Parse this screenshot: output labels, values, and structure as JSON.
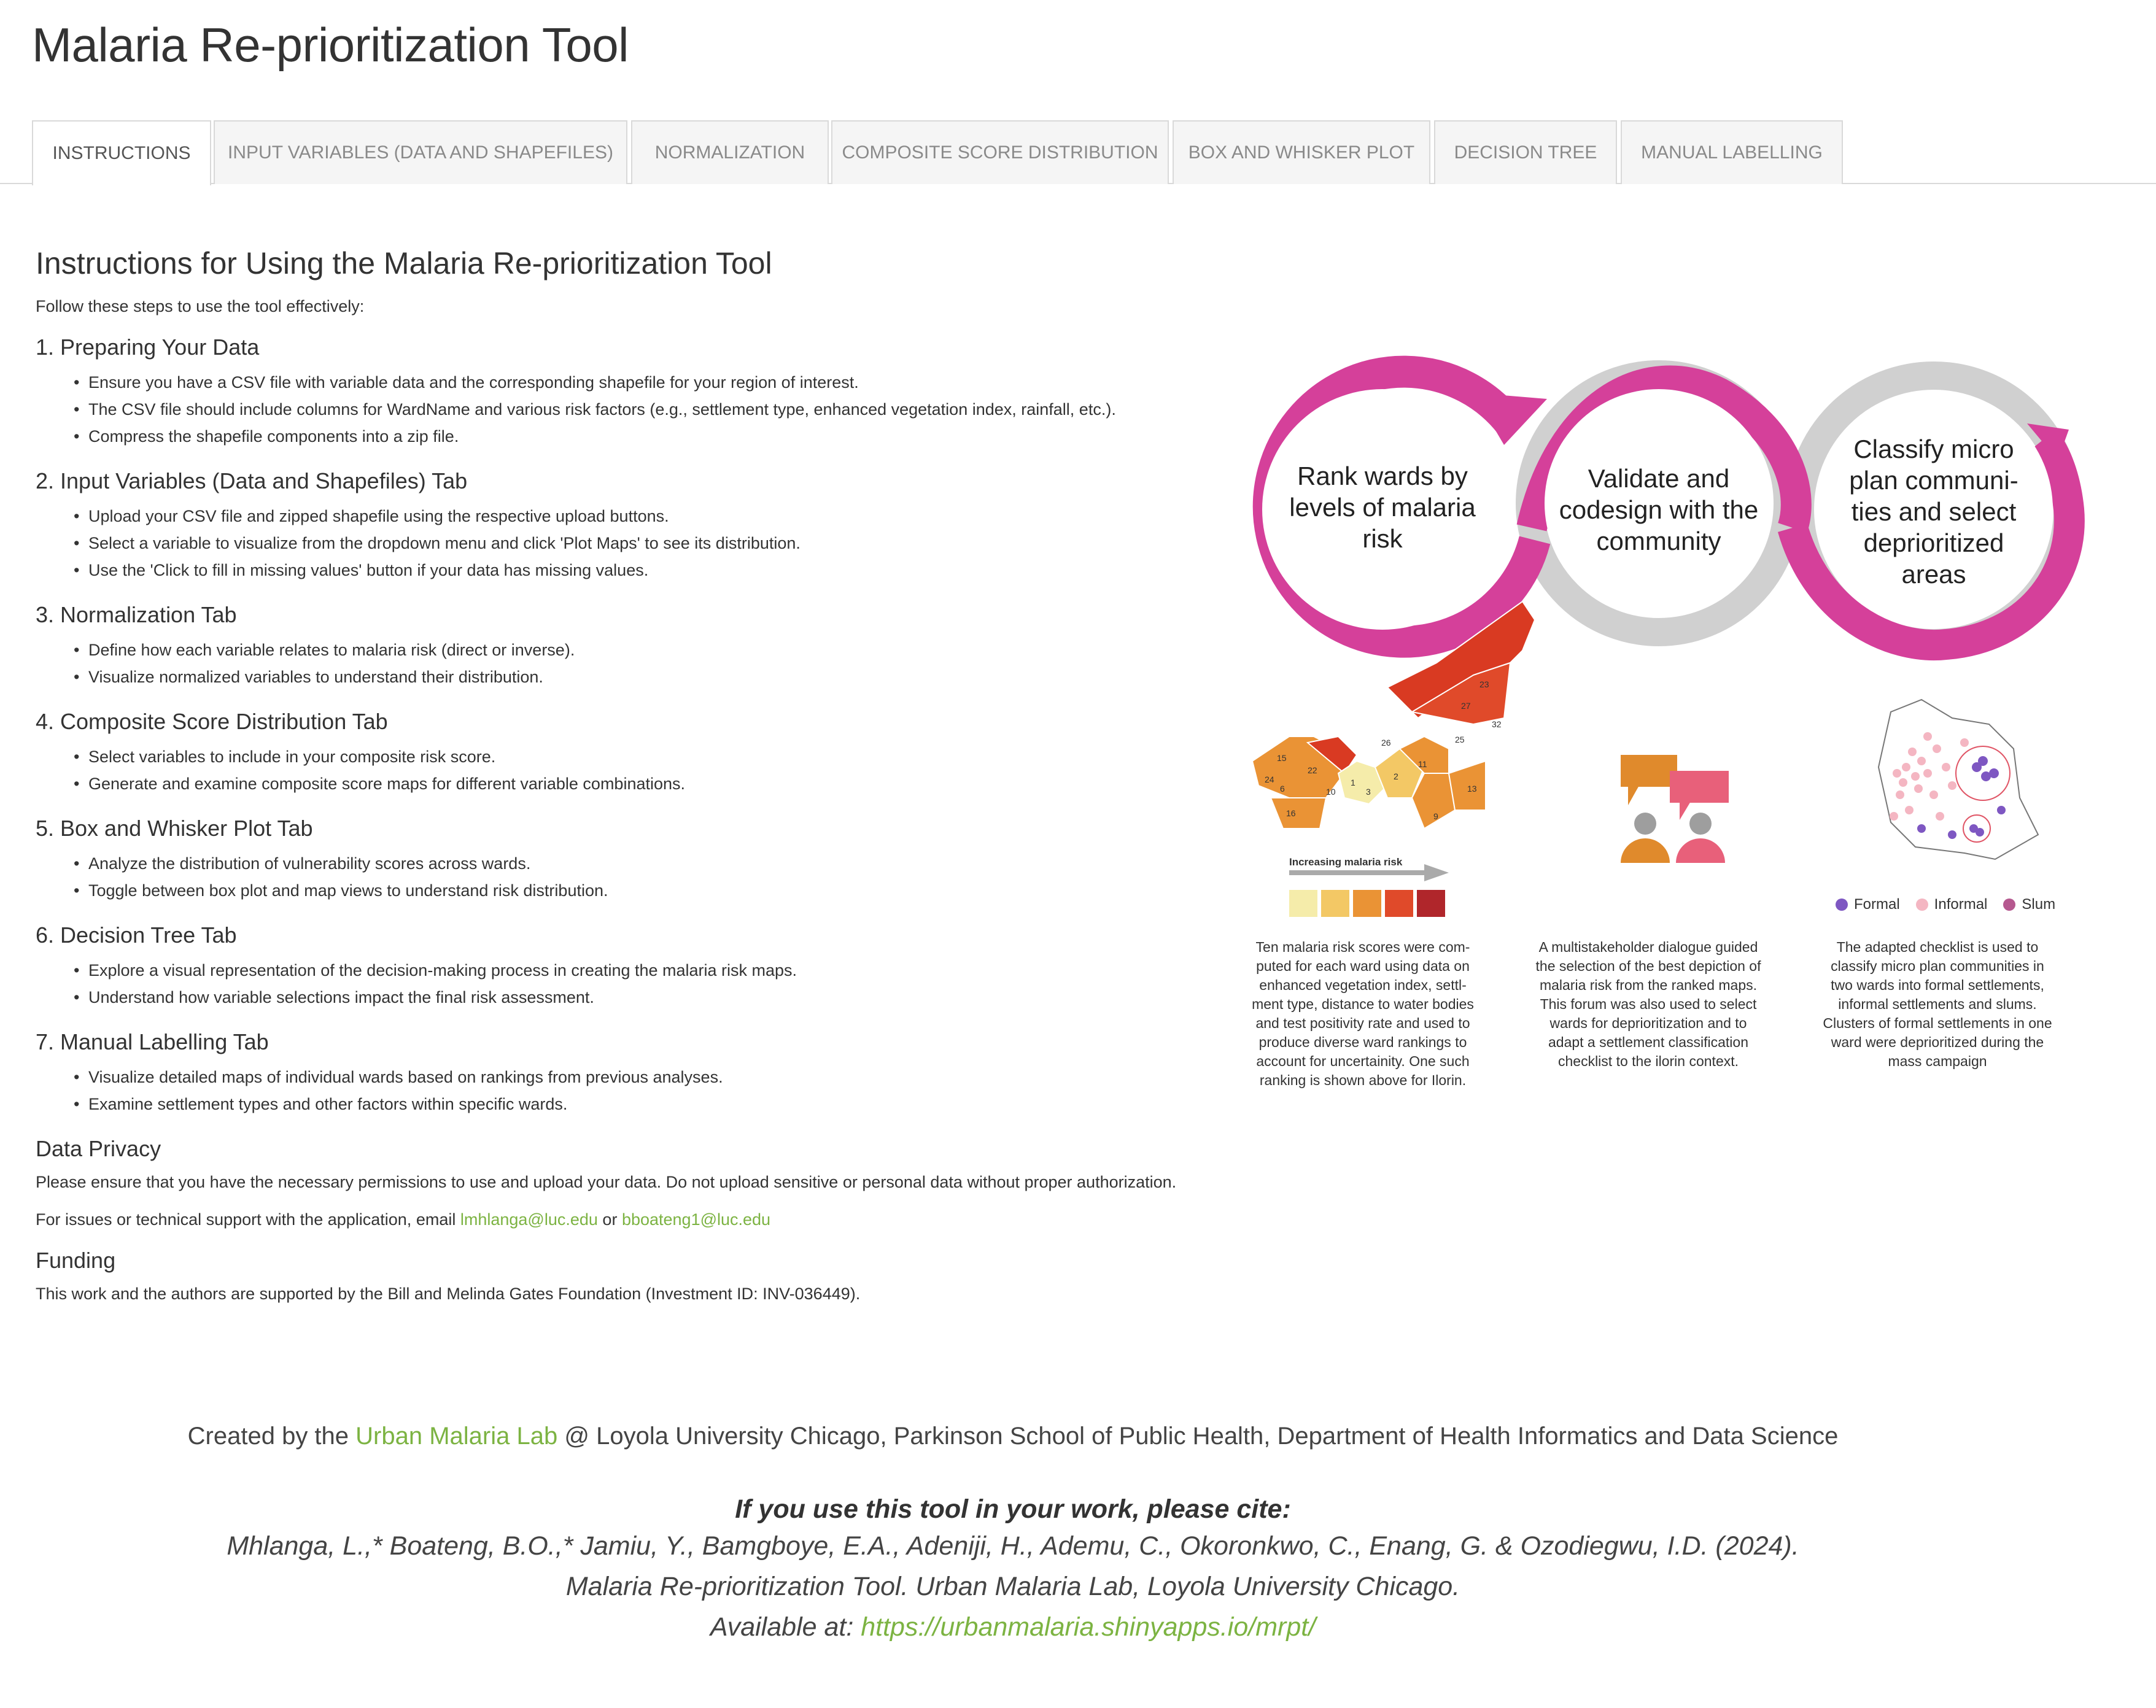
{
  "app": {
    "title": "Malaria Re-prioritization Tool"
  },
  "tabs": [
    {
      "label": "INSTRUCTIONS"
    },
    {
      "label": "INPUT VARIABLES (DATA AND SHAPEFILES)"
    },
    {
      "label": "NORMALIZATION"
    },
    {
      "label": "COMPOSITE SCORE DISTRIBUTION"
    },
    {
      "label": "BOX AND WHISKER PLOT"
    },
    {
      "label": "DECISION TREE"
    },
    {
      "label": "MANUAL LABELLING"
    }
  ],
  "instructions": {
    "heading": "Instructions for Using the Malaria Re-prioritization Tool",
    "intro": "Follow these steps to use the tool effectively:",
    "sections": [
      {
        "title": "1. Preparing Your Data",
        "items": [
          "Ensure you have a CSV file with variable data and the corresponding shapefile for your region of interest.",
          "The CSV file should include columns for WardName and various risk factors (e.g., settlement type, enhanced vegetation index, rainfall, etc.).",
          "Compress the shapefile components into a zip file."
        ]
      },
      {
        "title": "2. Input Variables (Data and Shapefiles) Tab",
        "items": [
          "Upload your CSV file and zipped shapefile using the respective upload buttons.",
          "Select a variable to visualize from the dropdown menu and click 'Plot Maps' to see its distribution.",
          "Use the 'Click to fill in missing values' button if your data has missing values."
        ]
      },
      {
        "title": "3. Normalization Tab",
        "items": [
          "Define how each variable relates to malaria risk (direct or inverse).",
          "Visualize normalized variables to understand their distribution."
        ]
      },
      {
        "title": "4. Composite Score Distribution Tab",
        "items": [
          "Select variables to include in your composite risk score.",
          "Generate and examine composite score maps for different variable combinations."
        ]
      },
      {
        "title": "5. Box and Whisker Plot Tab",
        "items": [
          "Analyze the distribution of vulnerability scores across wards.",
          "Toggle between box plot and map views to understand risk distribution."
        ]
      },
      {
        "title": "6. Decision Tree Tab",
        "items": [
          "Explore a visual representation of the decision-making process in creating the malaria risk maps.",
          "Understand how variable selections impact the final risk assessment."
        ]
      },
      {
        "title": "7. Manual Labelling Tab",
        "items": [
          "Visualize detailed maps of individual wards based on rankings from previous analyses.",
          "Examine settlement types and other factors within specific wards."
        ]
      }
    ],
    "privacy_title": "Data Privacy",
    "privacy_text": "Please ensure that you have the necessary permissions to use and upload your data. Do not upload sensitive or personal data without proper authorization.",
    "support_prefix": "For issues or technical support with the application, email",
    "email1": "lmhlanga@luc.edu",
    "or_text": "or",
    "email2": "bboateng1@luc.edu",
    "funding_title": "Funding",
    "funding_text": "This work and the authors are supported by the Bill and Melinda Gates Foundation (Investment ID: INV-036449)."
  },
  "figure": {
    "ring1": [
      "Rank wards by",
      "levels of malaria",
      "risk"
    ],
    "ring2": [
      "Validate and",
      "codesign with the",
      "community"
    ],
    "ring3": [
      "Classify micro",
      "plan communi-",
      "ties and select",
      "deprioritized",
      "areas"
    ],
    "ward_numbers": [
      "23",
      "27",
      "25",
      "32",
      "26",
      "15",
      "22",
      "24",
      "6",
      "1",
      "2",
      "10",
      "11",
      "13",
      "16",
      "3",
      "9"
    ],
    "risk_label": "Increasing malaria risk",
    "risk_colors": [
      "#f5ecaa",
      "#f3c865",
      "#ea9335",
      "#e04a2a",
      "#b0262b"
    ],
    "legend": [
      {
        "label": "Formal",
        "color": "#7e57c2"
      },
      {
        "label": "Informal",
        "color": "#f4b6c2"
      },
      {
        "label": "Slum",
        "color": "#b5588f"
      }
    ],
    "caption1": [
      "Ten malaria risk scores were com-",
      "puted for each ward using data on",
      "enhanced vegetation index, settl-",
      "ment type, distance to water bodies",
      "and test positivity rate and used to",
      "produce diverse ward rankings to",
      "account for uncertainity. One such",
      "ranking is shown above for Ilorin."
    ],
    "caption2": [
      "A multistakeholder dialogue guided",
      "the selection of the best depiction of",
      "malaria risk from the ranked maps.",
      "This forum was also used to select",
      "wards for deprioritization and to",
      "adapt a settlement classification",
      "checklist to the ilorin context."
    ],
    "caption3": [
      "The adapted checklist is used to",
      "classify micro plan communities in",
      "two wards into formal settlements,",
      "informal settlements and slums.",
      "Clusters of formal settlements in one",
      "ward were deprioritized during the",
      "mass campaign"
    ],
    "colors": {
      "magenta": "#d5409a",
      "grey": "#d0d0d0",
      "orange": "#e08a2c",
      "pink": "#e8607a",
      "person": "#9e9e9e"
    }
  },
  "footer": {
    "created_prefix": "Created by the",
    "lab_name": "Urban Malaria Lab",
    "created_suffix": "@ Loyola University Chicago, Parkinson School of Public Health, Department of Health Informatics and Data Science",
    "cite_heading": "If you use this tool in your work, please cite:",
    "cite_line1": "Mhlanga, L.,* Boateng, B.O.,* Jamiu, Y., Bamgboye, E.A., Adeniji, H., Ademu, C., Okoronkwo, C., Enang, G. & Ozodiegwu, I.D. (2024).",
    "cite_line2": "Malaria Re-prioritization Tool. Urban Malaria Lab, Loyola University Chicago.",
    "available_prefix": "Available at:",
    "url": "https://urbanmalaria.shinyapps.io/mrpt/"
  },
  "accent_color": "#7cb342"
}
